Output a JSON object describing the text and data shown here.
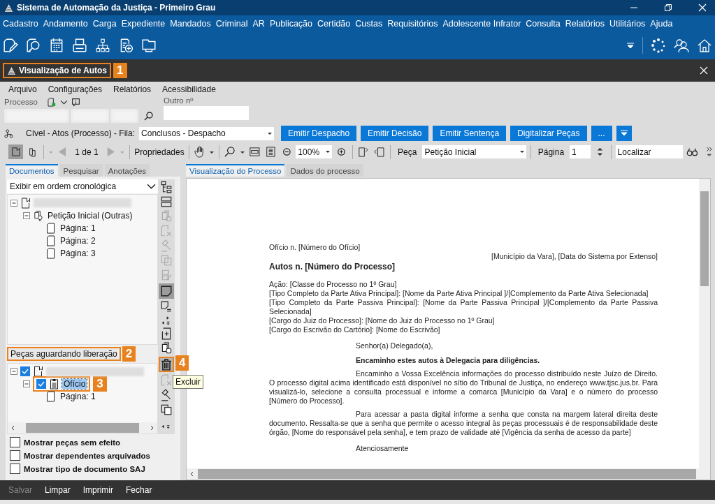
{
  "window": {
    "title": "Sistema de Automação da Justiça - Primeiro Grau"
  },
  "menu": [
    "Cadastro",
    "Andamento",
    "Carga",
    "Expediente",
    "Mandados",
    "Criminal",
    "AR",
    "Publicação",
    "Certidão",
    "Custas",
    "Requisitórios",
    "Adolescente Infrator",
    "Consulta",
    "Relatórios",
    "Utilitários",
    "Ajuda"
  ],
  "document_tab": {
    "title": "Visualização de Autos",
    "callout": "1"
  },
  "submenu": [
    "Arquivo",
    "Configurações",
    "Relatórios",
    "Acessibilidade"
  ],
  "process": {
    "label": "Processo",
    "other_label": "Outro nº"
  },
  "queue": {
    "label": "Cível - Atos (Processo) - Fila:",
    "value": "Conclusos - Despacho"
  },
  "actions": [
    "Emitir Despacho",
    "Emitir Decisão",
    "Emitir Sentença",
    "Digitalizar Peças",
    "..."
  ],
  "viewer_toolbar": {
    "pager": "1 de 1",
    "properties": "Propriedades",
    "zoom": "100%",
    "piece_label": "Peça",
    "piece": "Petição Inicial",
    "page_label": "Página",
    "page": "1",
    "search": "Localizar"
  },
  "left_tabs": [
    {
      "label": "Documentos",
      "selected": true
    },
    {
      "label": "Pesquisar",
      "selected": false
    },
    {
      "label": "Anotações",
      "selected": false
    }
  ],
  "order": "Exibir em ordem cronológica",
  "tree": [
    {
      "kind": "process",
      "children": [
        {
          "kind": "piece",
          "label": "Petição Inicial (Outras)",
          "children": [
            {
              "kind": "page",
              "label": "Página: 1"
            },
            {
              "kind": "page",
              "label": "Página: 2"
            },
            {
              "kind": "page",
              "label": "Página: 3"
            }
          ]
        }
      ]
    }
  ],
  "pending": {
    "title": "Peças aguardando liberação",
    "callout": "2",
    "tree": [
      {
        "kind": "process",
        "checked": true,
        "children": [
          {
            "kind": "letter",
            "label": "Ofício",
            "checked": true,
            "selected": true,
            "callout": "3",
            "children": [
              {
                "kind": "page",
                "label": "Página: 1"
              }
            ]
          }
        ]
      }
    ]
  },
  "options": [
    {
      "label": "Mostrar peças sem efeito",
      "checked": false
    },
    {
      "label": "Mostrar dependentes arquivados",
      "checked": false
    },
    {
      "label": "Mostrar tipo de documento SAJ",
      "checked": false
    }
  ],
  "delete_tool": {
    "callout": "4",
    "tooltip": "Excluir"
  },
  "viewer_tabs": [
    {
      "label": "Visualização do Processo",
      "selected": true
    },
    {
      "label": "Dados do processo",
      "selected": false
    }
  ],
  "document": [
    {
      "kind": "plain",
      "text": "Ofício n. [Número do Ofício]"
    },
    {
      "kind": "right",
      "text": "[Município da Vara], [Data do Sistema por Extenso]"
    },
    {
      "kind": "heading",
      "text": "Autos n. [Número do Processo]"
    },
    {
      "kind": "field",
      "text": "Ação: [Classe do Processo no 1º Grau]"
    },
    {
      "kind": "field",
      "text": "[Tipo Completo da Parte Ativa Principal]: [Nome da Parte Ativa Principal ]/[Complemento da Parte Ativa Selecionada]"
    },
    {
      "kind": "field",
      "text": "[Tipo Completo da Parte Passiva Principal]: [Nome da Parte Passiva Principal ]/[Complemento da Parte Passiva Selecionada]"
    },
    {
      "kind": "field",
      "text": "[Cargo do Juiz do Processo]: [Nome do Juiz do Processo no 1º Grau]"
    },
    {
      "kind": "field",
      "text": "[Cargo do Escrivão do Cartório]: [Nome do Escrivão]"
    },
    {
      "kind": "salutation",
      "text": "Senhor(a) Delegado(a),"
    },
    {
      "kind": "emphasis",
      "text": "Encaminho estes autos à Delegacia para diligências."
    },
    {
      "kind": "body",
      "text": "Encaminho a Vossa Excelência informações do processo distribuído neste Juízo de Direito. O processo digital acima identificado está disponível no sítio do Tribunal de Justiça, no endereço www.tjsc.jus.br. Para visualizá-lo, selecione a consulta processual e informe a comarca  [Município da Vara] e o número do processo [Número do Processo]."
    },
    {
      "kind": "body",
      "text": "Para acessar a pasta digital informe a senha que consta na margem lateral direita deste documento. Ressalta-se que a senha que permite o acesso integral às peças processuais é de responsabilidade deste órgão, [Nome do responsável pela senha], e tem prazo de validade até [Vigência da senha de acesso da parte]"
    },
    {
      "kind": "salutation",
      "text": "Atenciosamente"
    }
  ],
  "footer": [
    {
      "label": "Salvar",
      "disabled": true
    },
    {
      "label": "Limpar",
      "disabled": false
    },
    {
      "label": "Imprimir",
      "disabled": false
    },
    {
      "label": "Fechar",
      "disabled": false
    }
  ]
}
